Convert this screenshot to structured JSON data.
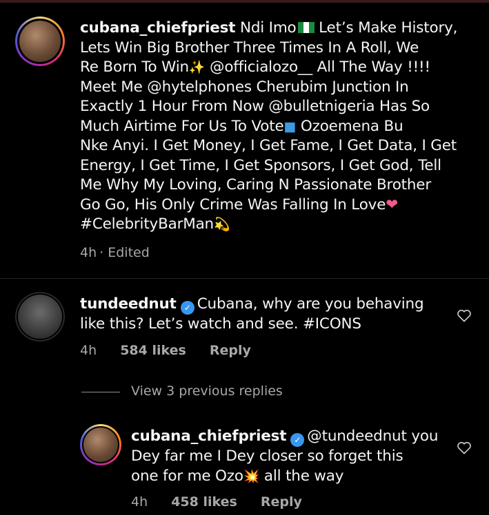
{
  "comments": [
    {
      "username": "cubana_chiefpriest",
      "text_lines": [
        "Ndi Imo",
        "Let’s Make History,",
        "Lets Win Big Brother Three Times In A Roll, We",
        "Re Born To Win",
        "@officialozo__ All The Way !!!!",
        "Meet Me @hytelphones Cherubim Junction In",
        "Exactly 1 Hour From Now @bulletnigeria Has So",
        "Much Airtime For Us To Vote",
        "Ozoemena Bu",
        "Nke Anyi. I Get Money, I Get Fame, I Get Data, I Get",
        "Energy, I Get Time, I Get Sponsors, I Get God, Tell",
        "Me Why My Loving, Caring N Passionate Brother",
        "Go Go, His Only Crime Was Falling In Love",
        "#CelebrityBarMan"
      ],
      "time": "4h",
      "edited": "Edited"
    },
    {
      "username": "tundeednut",
      "text_lines": [
        "Cubana, why are you behaving",
        "like this? Let’s watch and see. #ICONS"
      ],
      "time": "4h",
      "likes": "584 likes",
      "reply": "Reply"
    }
  ],
  "view_replies": "View 3 previous replies",
  "reply": {
    "username": "cubana_chiefpriest",
    "text_lines": [
      "@tundeednut you",
      "Dey far me I Dey closer so forget this",
      "one for me Ozo",
      "all the way"
    ],
    "time": "4h",
    "likes": "458 likes",
    "reply": "Reply"
  },
  "icons": {
    "flag": "nigeria-flag-emoji",
    "sparkles": "sparkles-emoji",
    "ballot": "ballot-box-emoji",
    "heart": "pink-heart-emoji",
    "dizzy": "dizzy-emoji",
    "collision": "collision-emoji",
    "like": "heart-outline-icon",
    "verified": "verified-badge-icon"
  },
  "colors": {
    "background": "#000000",
    "text": "#f5f5f5",
    "muted": "#a8a8a8",
    "verified": "#3897f0"
  }
}
